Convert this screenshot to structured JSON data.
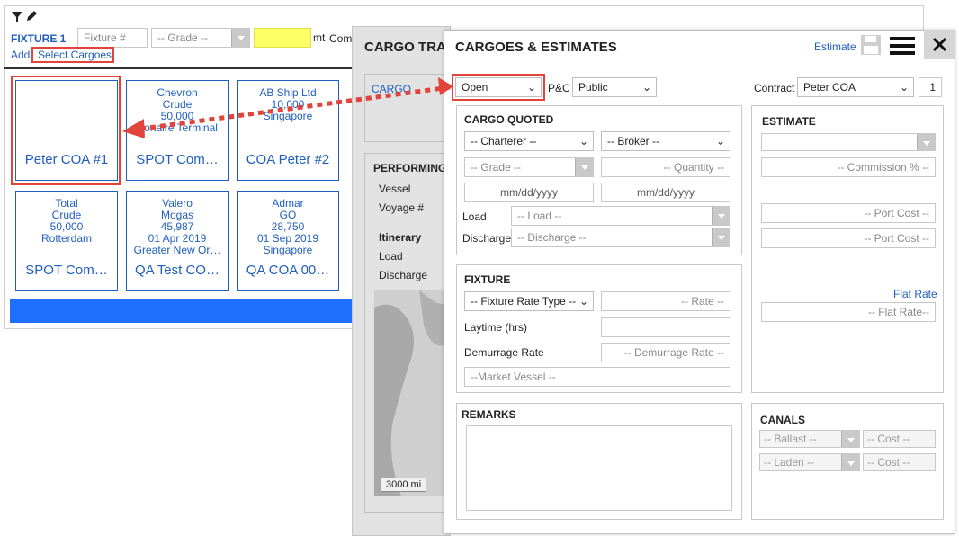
{
  "background": {
    "fixture_label": "FIXTURE 1",
    "fixture_placeholder": "Fixture #",
    "grade_placeholder": "-- Grade --",
    "mt_label": "mt",
    "com_label": "Com",
    "add_link": "Add",
    "select_cargoes_link": "Select Cargoes",
    "cards": [
      {
        "lines": [
          "",
          "",
          "",
          ""
        ],
        "title": "Peter COA #1",
        "selected": true
      },
      {
        "lines": [
          "Chevron",
          "Crude",
          "50,000",
          "",
          "Bonaire Terminal"
        ],
        "title": "SPOT Com…"
      },
      {
        "lines": [
          "AB Ship Ltd",
          "",
          "10,000",
          "",
          "Singapore"
        ],
        "title": "COA Peter #2"
      },
      {
        "lines": [
          "Total",
          "Crude",
          "50,000",
          "",
          "Rotterdam"
        ],
        "title": "SPOT Com…"
      },
      {
        "lines": [
          "Valero",
          "Mogas",
          "45,987",
          "01 Apr 2019",
          "Greater New Or…"
        ],
        "title": "QA Test CO…"
      },
      {
        "lines": [
          "Admar",
          "GO",
          "28,750",
          "01 Sep 2019",
          "Singapore"
        ],
        "title": "QA COA 00…"
      }
    ],
    "accent_color": "#1f6fff"
  },
  "cargo_panel": {
    "title": "CARGO TRA",
    "cargo_link": "CARGO",
    "performing": "PERFORMING",
    "vessel": "Vessel",
    "voyage": "Voyage #",
    "itinerary": "Itinerary",
    "load": "Load",
    "discharge": "Discharge",
    "scale": "3000 mi"
  },
  "dialog": {
    "title": "CARGOES & ESTIMATES",
    "estimate_link": "Estimate",
    "status": "Open",
    "pc_label": "P&C",
    "pc_value": "Public",
    "contract_label": "Contract",
    "contract_value": "Peter COA",
    "contract_count": "1",
    "cargo_quoted": {
      "title": "CARGO QUOTED",
      "charterer": "-- Charterer --",
      "broker": "-- Broker --",
      "grade": "-- Grade --",
      "quantity": "-- Quantity --",
      "date1": "mm/dd/yyyy",
      "date2": "mm/dd/yyyy",
      "load_label": "Load",
      "load_placeholder": "-- Load --",
      "discharge_label": "Discharge",
      "discharge_placeholder": "-- Discharge --"
    },
    "fixture": {
      "title": "FIXTURE",
      "rate_type": "-- Fixture Rate Type --",
      "rate": "-- Rate --",
      "laytime_label": "Laytime (hrs)",
      "demurrage_label": "Demurrage Rate",
      "demurrage_placeholder": "-- Demurrage Rate --",
      "market_vessel": "--Market Vessel --"
    },
    "estimate": {
      "title": "ESTIMATE",
      "commission": "-- Commission % --",
      "port_cost_1": "-- Port Cost --",
      "port_cost_2": "-- Port Cost --",
      "flat_rate_link": "Flat Rate",
      "flat_rate_placeholder": "-- Flat Rate--"
    },
    "remarks": {
      "title": "REMARKS"
    },
    "canals": {
      "title": "CANALS",
      "ballast": "-- Ballast --",
      "laden": "-- Laden --",
      "cost1": "-- Cost --",
      "cost2": "-- Cost --"
    }
  }
}
